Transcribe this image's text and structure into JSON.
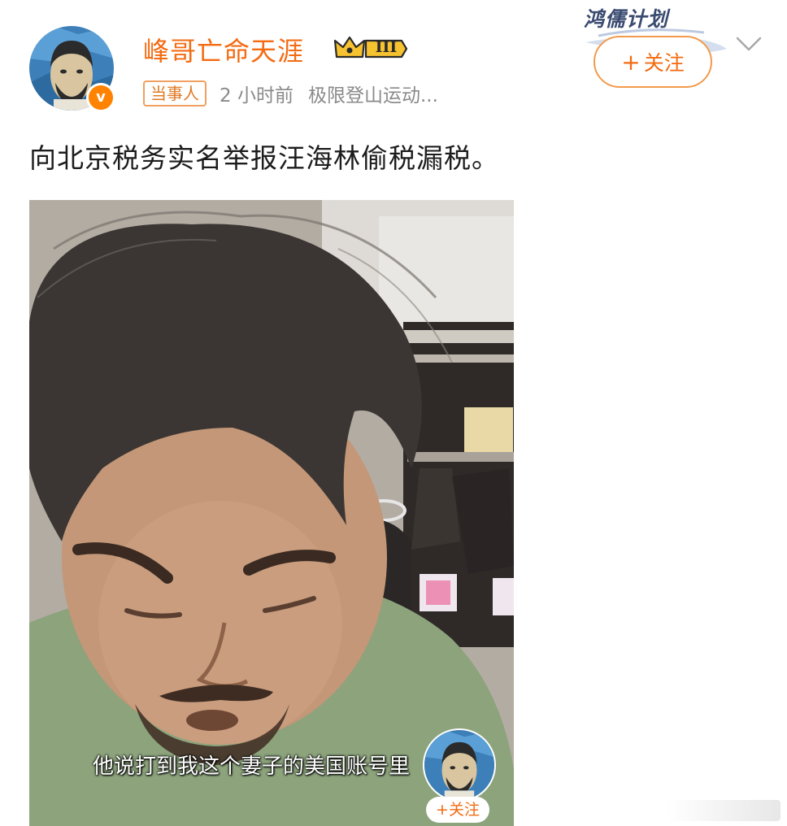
{
  "post": {
    "author": {
      "name": "峰哥亡命天涯",
      "vip_level": "III",
      "role_tag": "当事人",
      "verified_mark": "v"
    },
    "meta": {
      "time": "2 小时前",
      "source": "极限登山运动..."
    },
    "watermark": "鸿儒计划",
    "follow_button": {
      "plus": "+",
      "label": "关注"
    },
    "text": "向北京税务实名举报汪海林偷税漏税。",
    "video": {
      "subtitle": "他说打到我这个妻子的美国账号里",
      "mini_follow_label": "+关注"
    }
  },
  "colors": {
    "accent_orange": "#f36b12",
    "tag_border": "#f0a060",
    "muted_text": "#8a8a8a"
  },
  "icons": {
    "chevron": "chevron-down-icon",
    "crown": "crown-icon",
    "verified": "verified-badge-icon"
  }
}
